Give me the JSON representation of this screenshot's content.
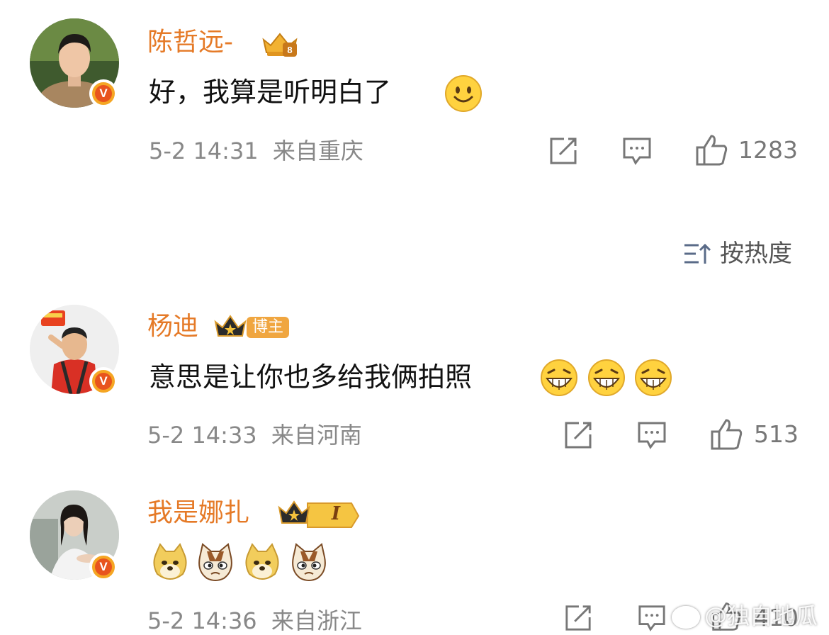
{
  "comments": [
    {
      "name": "陈哲远-",
      "text": "好，我算是听明白了",
      "emojis": [
        "smile-emoji"
      ],
      "date": "5-2 14:31",
      "location": "来自重庆",
      "likes": "1283"
    },
    {
      "name": "杨迪",
      "badge": "博主",
      "text": "意思是让你也多给我俩拍照",
      "emojis": [
        "grin-emoji",
        "grin-emoji",
        "grin-emoji"
      ],
      "date": "5-2 14:33",
      "location": "来自河南",
      "likes": "513"
    },
    {
      "name": "我是娜扎",
      "level": "I",
      "text": "",
      "emojis": [
        "doge-emoji",
        "cat-emoji",
        "doge-emoji",
        "cat-emoji"
      ],
      "date": "5-2 14:36",
      "location": "来自浙江",
      "likes": "410"
    }
  ],
  "sort": {
    "label": "按热度",
    "icon": "sort-icon"
  },
  "verified_mark": "V",
  "watermark": "@独自地瓜",
  "colors": {
    "name": "#e57a27",
    "meta": "#888888",
    "badge": "#f5a623"
  }
}
